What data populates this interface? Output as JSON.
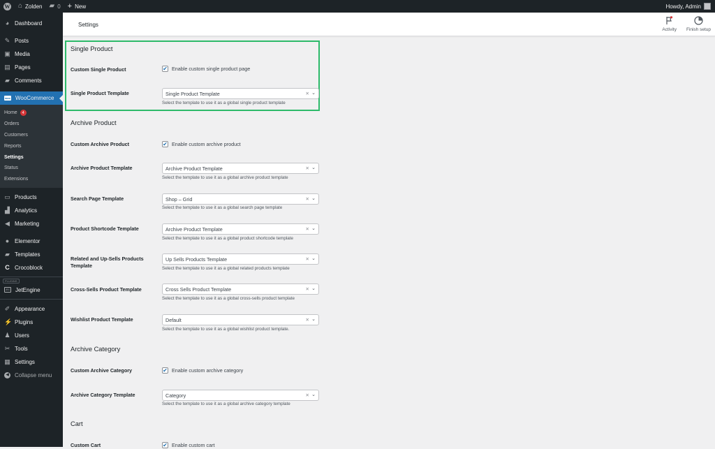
{
  "adminbar": {
    "site_name": "Zolden",
    "comments_count": "0",
    "new_label": "New",
    "greeting": "Howdy, Admin"
  },
  "sidebar": {
    "top_items": [
      {
        "label": "Dashboard",
        "icon": "dashboard-icon"
      }
    ],
    "content_items": [
      {
        "label": "Posts",
        "icon": "pin-icon"
      },
      {
        "label": "Media",
        "icon": "media-icon"
      },
      {
        "label": "Pages",
        "icon": "pages-icon"
      },
      {
        "label": "Comments",
        "icon": "comment-icon"
      }
    ],
    "woocommerce": {
      "label": "WooCommerce",
      "icon_text": "woo",
      "submenu": [
        {
          "label": "Home",
          "badge": "4"
        },
        {
          "label": "Orders"
        },
        {
          "label": "Customers"
        },
        {
          "label": "Reports"
        },
        {
          "label": "Settings",
          "current": true
        },
        {
          "label": "Status"
        },
        {
          "label": "Extensions"
        }
      ]
    },
    "commerce_items": [
      {
        "label": "Products"
      },
      {
        "label": "Analytics"
      },
      {
        "label": "Marketing"
      }
    ],
    "builder_items": [
      {
        "label": "Elementor"
      },
      {
        "label": "Templates"
      },
      {
        "label": "Crocoblock"
      }
    ],
    "plugins_tag": "PLUGINS",
    "jetengine": {
      "label": "JetEngine",
      "icon_text": "JEC"
    },
    "admin_items": [
      {
        "label": "Appearance"
      },
      {
        "label": "Plugins"
      },
      {
        "label": "Users"
      },
      {
        "label": "Tools"
      },
      {
        "label": "Settings"
      }
    ],
    "collapse_label": "Collapse menu"
  },
  "header": {
    "title": "Settings",
    "activity_label": "Activity",
    "finish_setup_label": "Finish setup"
  },
  "main": {
    "single_product": {
      "title": "Single Product",
      "custom_label": "Custom Single Product",
      "custom_checkbox": "Enable custom single product page",
      "custom_checked": true,
      "template_label": "Single Product Template",
      "template_value": "Single Product Template",
      "template_desc": "Select the template to use it as a global single product template"
    },
    "archive_product": {
      "title": "Archive Product",
      "custom_label": "Custom Archive Product",
      "custom_checkbox": "Enable custom archive product",
      "custom_checked": true,
      "fields": [
        {
          "label": "Archive Product Template",
          "value": "Archive Product Template",
          "desc": "Select the template to use it as a global archive product template"
        },
        {
          "label": "Search Page Template",
          "value": "Shop – Grid",
          "desc": "Select the template to use it as a global search page template"
        },
        {
          "label": "Product Shortcode Template",
          "value": "Archive Product Template",
          "desc": "Select the template to use it as a global product shortcode template"
        },
        {
          "label": "Related and Up-Sells Products Template",
          "value": "Up Sells Products Template",
          "desc": "Select the template to use it as a global related products template"
        },
        {
          "label": "Cross-Sells Product Template",
          "value": "Cross Sells Product Template",
          "desc": "Select the template to use it as a global cross-sells product template"
        },
        {
          "label": "Wishlist Product Template",
          "value": "Default",
          "desc": "Select the template to use it as a global wishlist product template."
        }
      ]
    },
    "archive_category": {
      "title": "Archive Category",
      "custom_label": "Custom Archive Category",
      "custom_checkbox": "Enable custom archive category",
      "custom_checked": true,
      "template_label": "Archive Category Template",
      "template_value": "Category",
      "template_desc": "Select the template to use it as a global archive category template"
    },
    "cart": {
      "title": "Cart",
      "custom_label": "Custom Cart",
      "custom_checkbox": "Enable custom cart",
      "custom_checked": true
    },
    "highlight_color": "#2dba6a"
  }
}
